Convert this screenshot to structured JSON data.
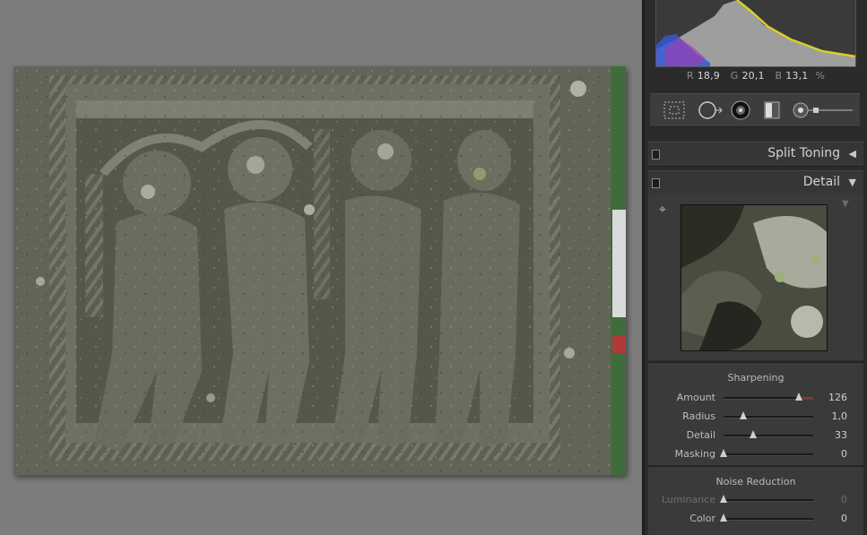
{
  "histogram": {
    "r_label": "R",
    "r_value": "18,9",
    "g_label": "G",
    "g_value": "20,1",
    "b_label": "B",
    "b_value": "13,1",
    "unit": "%"
  },
  "tools": [
    "crop-overlay-icon",
    "spot-removal-icon",
    "red-eye-icon",
    "graduated-filter-icon",
    "adjustment-brush-icon"
  ],
  "sections": {
    "split_toning": {
      "title": "Split Toning",
      "collapsed": true
    },
    "detail": {
      "title": "Detail",
      "collapsed": false
    }
  },
  "sharpening": {
    "title": "Sharpening",
    "sliders": [
      {
        "label": "Amount",
        "value": "126",
        "fraction": 0.84,
        "dim": false
      },
      {
        "label": "Radius",
        "value": "1,0",
        "fraction": 0.22,
        "dim": false
      },
      {
        "label": "Detail",
        "value": "33",
        "fraction": 0.33,
        "dim": false
      },
      {
        "label": "Masking",
        "value": "0",
        "fraction": 0.0,
        "dim": false
      }
    ]
  },
  "noise_reduction": {
    "title": "Noise Reduction",
    "sliders": [
      {
        "label": "Luminance",
        "value": "0",
        "fraction": 0.0,
        "dim": true
      },
      {
        "label": "Color",
        "value": "0",
        "fraction": 0.0,
        "dim": false
      }
    ]
  },
  "colors": {
    "panel_bg": "#2b2b2b",
    "accent_amount_fill": "#8a3a3a",
    "histogram_yellow": "#d8cf2a",
    "histogram_blue": "#3a56d6"
  }
}
